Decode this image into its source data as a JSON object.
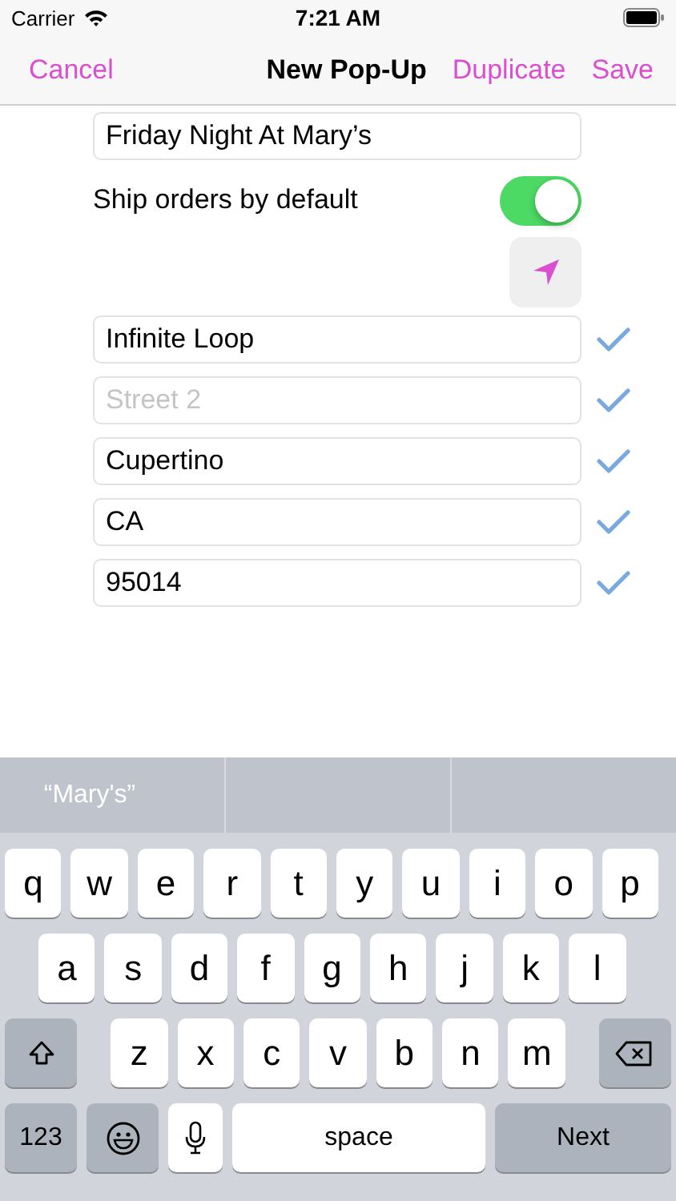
{
  "status_bar": {
    "carrier": "Carrier",
    "time": "7:21 AM"
  },
  "nav": {
    "cancel": "Cancel",
    "title": "New Pop-Up",
    "duplicate": "Duplicate",
    "save": "Save"
  },
  "name_field": {
    "value": "Friday Night At Mary’s"
  },
  "toggle": {
    "label": "Ship orders by default",
    "on": true
  },
  "address_fields": [
    {
      "value": "Infinite Loop",
      "checked": true
    },
    {
      "placeholder": "Street 2",
      "checked": true
    },
    {
      "value": "Cupertino",
      "checked": true
    },
    {
      "value": "CA",
      "checked": true
    },
    {
      "value": "95014",
      "checked": true
    }
  ],
  "keyboard": {
    "suggestions": [
      "“Mary's”"
    ],
    "rows": [
      [
        "q",
        "w",
        "e",
        "r",
        "t",
        "y",
        "u",
        "i",
        "o",
        "p"
      ],
      [
        "a",
        "s",
        "d",
        "f",
        "g",
        "h",
        "j",
        "k",
        "l"
      ],
      [
        "z",
        "x",
        "c",
        "v",
        "b",
        "n",
        "m"
      ]
    ],
    "numbers_key": "123",
    "space_key": "space",
    "return_key": "Next"
  }
}
